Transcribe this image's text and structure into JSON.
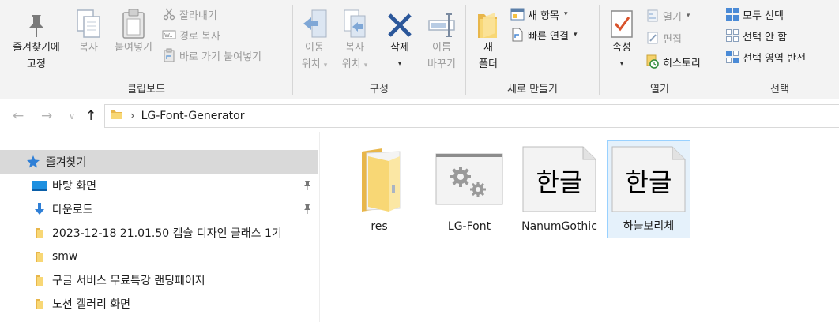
{
  "ribbon": {
    "clipboard": {
      "group_label": "클립보드",
      "pin_label_1": "즐겨찾기에",
      "pin_label_2": "고정",
      "copy_label": "복사",
      "paste_label": "붙여넣기",
      "cut_label": "잘라내기",
      "copy_path_label": "경로 복사",
      "paste_shortcut_label": "바로 가기 붙여넣기"
    },
    "organize": {
      "group_label": "구성",
      "move_label_1": "이동",
      "move_label_2": "위치",
      "copyto_label_1": "복사",
      "copyto_label_2": "위치",
      "delete_label": "삭제",
      "rename_label_1": "이름",
      "rename_label_2": "바꾸기"
    },
    "new": {
      "group_label": "새로 만들기",
      "new_folder_label_1": "새",
      "new_folder_label_2": "폴더",
      "new_item_label": "새 항목",
      "easy_access_label": "빠른 연결"
    },
    "open": {
      "group_label": "열기",
      "properties_label": "속성",
      "open_label": "열기",
      "edit_label": "편집",
      "history_label": "히스토리"
    },
    "select": {
      "group_label": "선택",
      "select_all_label": "모두 선택",
      "select_none_label": "선택 안 함",
      "invert_label": "선택 영역 반전"
    }
  },
  "address": {
    "path": "LG-Font-Generator"
  },
  "sidebar": {
    "items": [
      {
        "label": "즐겨찾기",
        "icon": "star-icon"
      },
      {
        "label": "바탕 화면",
        "icon": "desktop-icon"
      },
      {
        "label": "다운로드",
        "icon": "download-icon"
      },
      {
        "label": "2023-12-18 21.01.50 캡슐 디자인 클래스 1기",
        "icon": "folder-icon"
      },
      {
        "label": "smw",
        "icon": "folder-icon"
      },
      {
        "label": "구글 서비스 무료특강 랜딩페이지",
        "icon": "folder-icon"
      },
      {
        "label": "노션 캘러리 화면",
        "icon": "folder-icon"
      }
    ]
  },
  "files": [
    {
      "name": "res",
      "icon": "folder-icon"
    },
    {
      "name": "LG-Font",
      "icon": "settings-file-icon"
    },
    {
      "name": "NanumGothic",
      "icon": "font-file-icon",
      "glyph": "한글"
    },
    {
      "name": "하늘보리체",
      "icon": "font-file-icon",
      "glyph": "한글"
    }
  ],
  "colors": {
    "ribbon_bg": "#f3f3f3",
    "selected_nav": "#d9d9d9",
    "selected_file_bg": "#e5f1fb",
    "selected_file_border": "#99d1ff",
    "folder_yellow": "#f8d775",
    "delete_blue": "#2b579a"
  }
}
